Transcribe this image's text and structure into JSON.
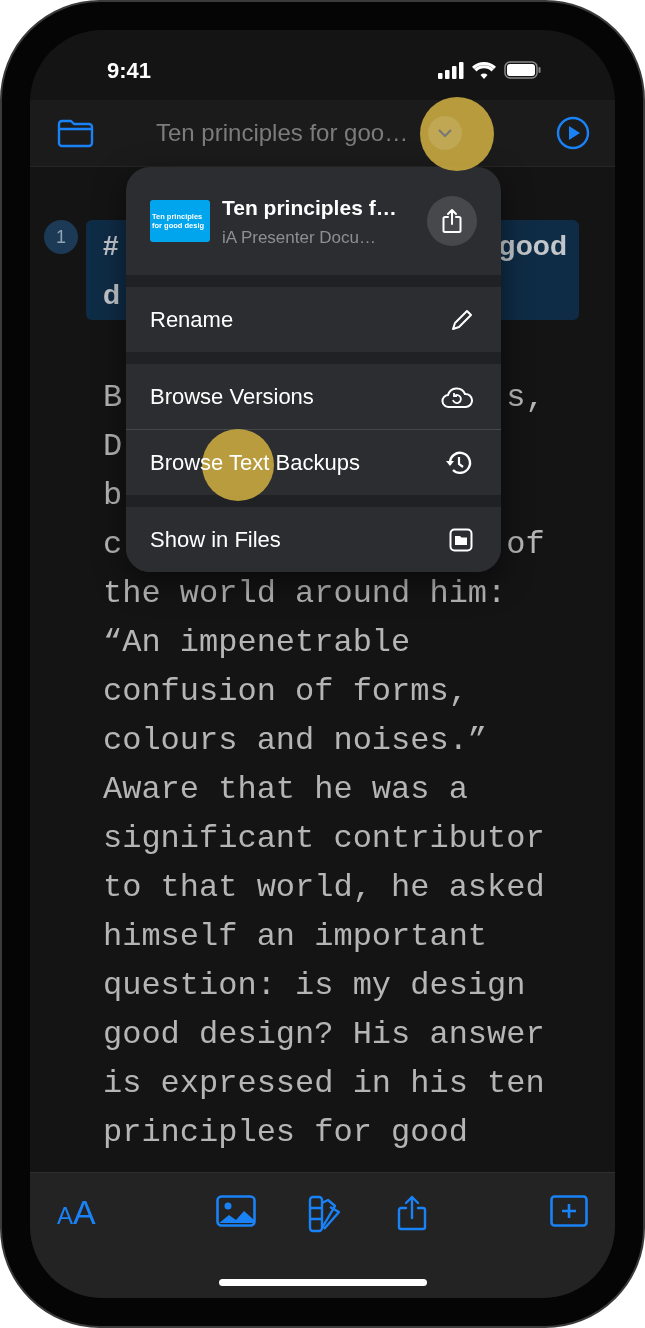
{
  "status_bar": {
    "time": "9:41"
  },
  "nav": {
    "title": "Ten principles for goo…"
  },
  "document": {
    "slide_number": "1",
    "heading_lines": [
      {
        "left": "#",
        "right": "good"
      },
      {
        "left": "d"
      }
    ],
    "partial_lines": [
      {
        "left": "B",
        "right": "s,"
      },
      {
        "left": "D"
      },
      {
        "left": "b"
      },
      {
        "left": "c",
        "right": "of"
      }
    ],
    "lines": [
      "the world around him:",
      "“An impenetrable",
      "confusion of forms,",
      "colours and noises.”",
      "Aware that he was a",
      "significant contributor",
      "to that world, he asked",
      "himself an important",
      "question: is my design",
      "good design? His answer",
      "is expressed in his ten",
      "principles for good"
    ]
  },
  "menu": {
    "header": {
      "title": "Ten principles f…",
      "subtitle": "iA Presenter Docu…",
      "thumbnail_lines": [
        "Ten principles",
        "for good desig"
      ]
    },
    "sections": [
      {
        "items": [
          {
            "label": "Rename"
          }
        ]
      },
      {
        "items": [
          {
            "label": "Browse Versions"
          },
          {
            "label": "Browse Text Backups"
          }
        ]
      },
      {
        "items": [
          {
            "label": "Show in Files"
          }
        ]
      }
    ]
  },
  "toolbar": {
    "font_button": {
      "small": "A",
      "large": "A"
    }
  }
}
